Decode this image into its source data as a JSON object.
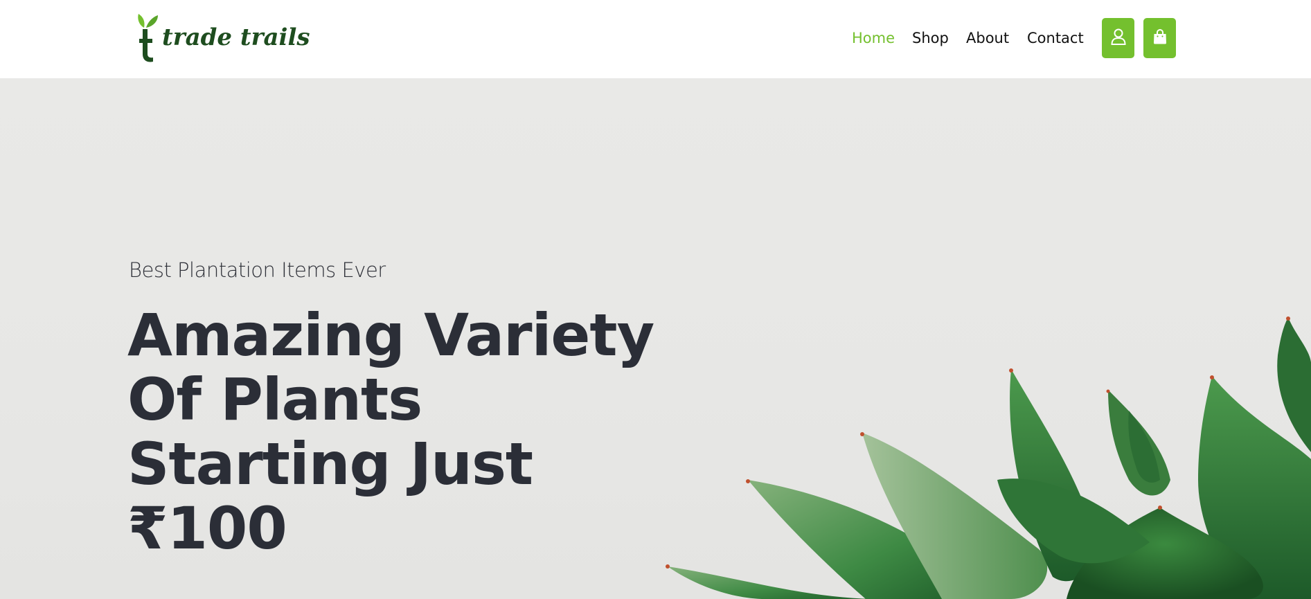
{
  "brand": {
    "name": "trade trails",
    "logo_letter": "t",
    "primary_color": "#74c02e",
    "dark_green": "#1e4d1f"
  },
  "nav": {
    "items": [
      {
        "label": "Home",
        "active": true
      },
      {
        "label": "Shop",
        "active": false
      },
      {
        "label": "About",
        "active": false
      },
      {
        "label": "Contact",
        "active": false
      }
    ],
    "account_icon": "user-icon",
    "cart_icon": "shopping-bag-icon"
  },
  "hero": {
    "subtitle": "Best Plantation Items Ever",
    "title": "Amazing Variety Of Plants Starting Just ₹100",
    "image_icon": "succulent-plant-image"
  }
}
